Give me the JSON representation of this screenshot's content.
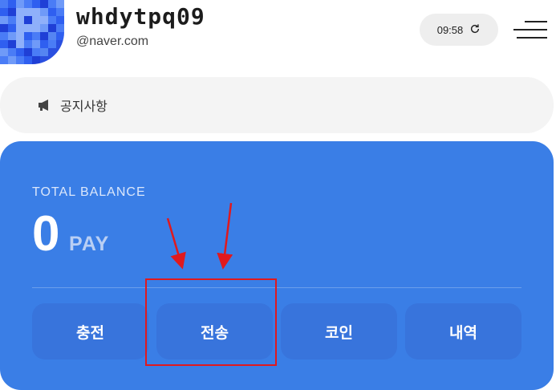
{
  "profile": {
    "username": "whdytpq09",
    "email": "@naver.com",
    "avatar_icon": "pixelated-avatar-icon"
  },
  "header": {
    "time": "09:58",
    "refresh_icon": "refresh-icon",
    "menu_icon": "hamburger-menu-icon"
  },
  "notice": {
    "label": "공지사항",
    "icon": "megaphone-icon"
  },
  "balance": {
    "label": "TOTAL BALANCE",
    "amount": "0",
    "unit": "PAY"
  },
  "actions": [
    {
      "label": "충전"
    },
    {
      "label": "전송"
    },
    {
      "label": "코인"
    },
    {
      "label": "내역"
    }
  ],
  "colors": {
    "card_bg": "#3a7ee6",
    "button_bg": "#3874dc",
    "annotation_red": "#e0191e"
  }
}
